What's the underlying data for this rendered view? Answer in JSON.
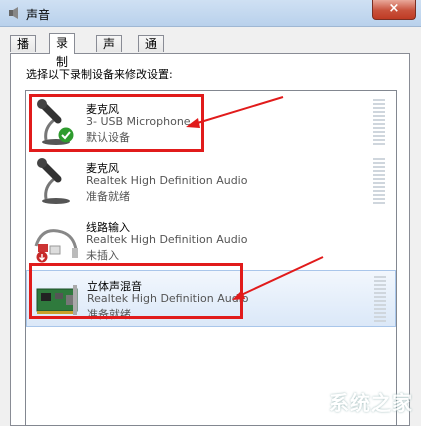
{
  "window": {
    "title": "声音",
    "close_label": "×"
  },
  "tabs": [
    {
      "label": "播放"
    },
    {
      "label": "录制",
      "active": true
    },
    {
      "label": "声音"
    },
    {
      "label": "通信"
    }
  ],
  "instruction": "选择以下录制设备来修改设置:",
  "devices": [
    {
      "name": "麦克风",
      "description": "3- USB Microphone",
      "status": "默认设备",
      "icon": "microphone-icon",
      "default": true
    },
    {
      "name": "麦克风",
      "description": "Realtek High Definition Audio",
      "status": "准备就绪",
      "icon": "microphone-icon"
    },
    {
      "name": "线路输入",
      "description": "Realtek High Definition Audio",
      "status": "未插入",
      "icon": "line-in-cable-icon"
    },
    {
      "name": "立体声混音",
      "description": "Realtek High Definition Audio",
      "status": "准备就绪",
      "icon": "sound-card-icon",
      "selected": true
    }
  ],
  "annotation_color": "#e11b1b",
  "watermark": "系统之家"
}
